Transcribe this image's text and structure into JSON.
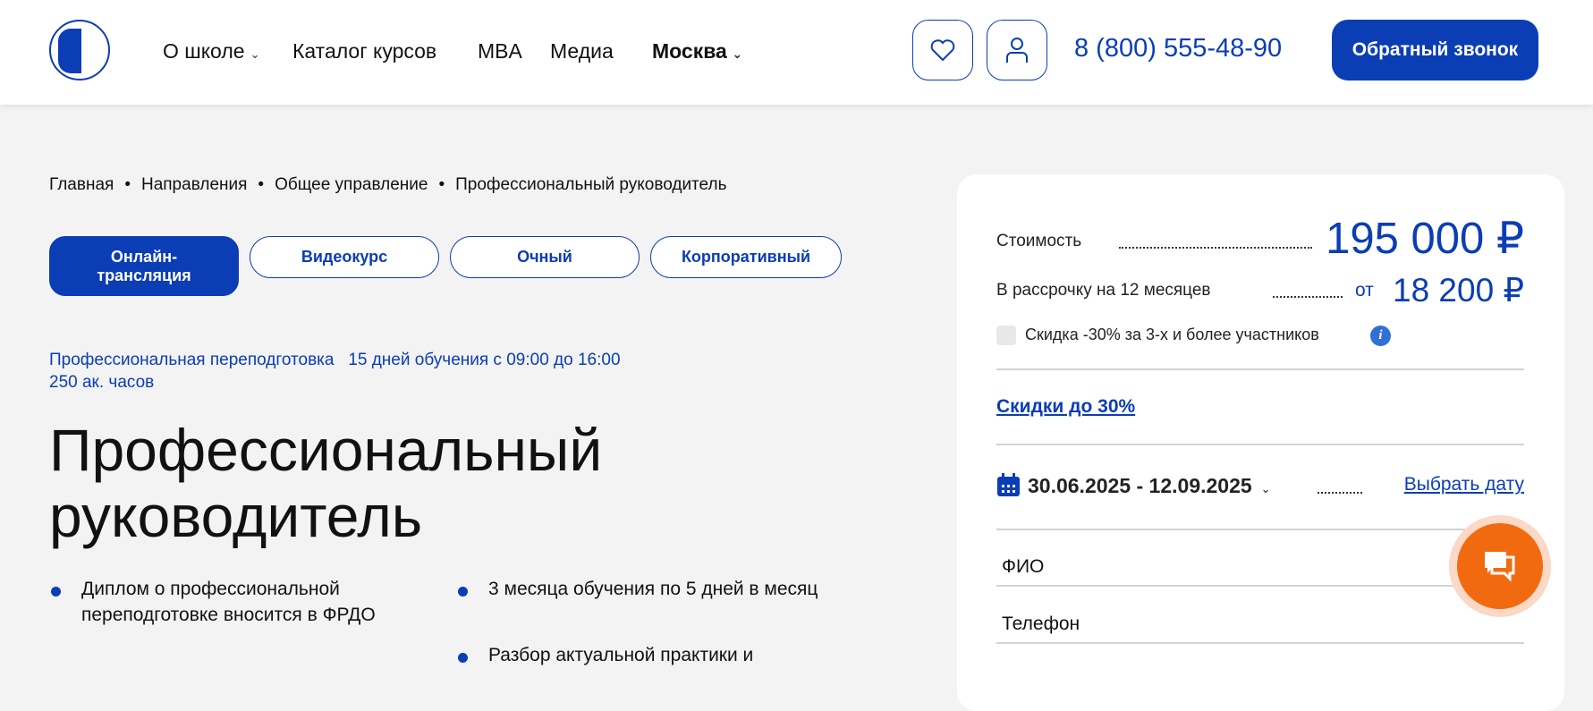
{
  "header": {
    "logo_alt": "lion logo",
    "nav": [
      {
        "label": "О школе",
        "dropdown": true
      },
      {
        "label": "Каталог курсов"
      },
      {
        "label": "MBA"
      },
      {
        "label": "Медиа"
      }
    ],
    "city": "Москва",
    "phone": "8 (800) 555-48-90",
    "callback_label": "Обратный звонок"
  },
  "breadcrumb": [
    "Главная",
    "Направления",
    "Общее управление",
    "Профессиональный руководитель"
  ],
  "format_tabs": [
    {
      "label": "Онлайн-трансляция",
      "active": true
    },
    {
      "label": "Видеокурс"
    },
    {
      "label": "Очный"
    },
    {
      "label": "Корпоративный"
    }
  ],
  "meta": {
    "type": "Профессиональная переподготовка",
    "schedule": "15 дней обучения с 09:00 до 16:00",
    "hours": "250 ак. часов"
  },
  "title_line1": "Профессиональный",
  "title_line2": "руководитель",
  "features": [
    "Диплом о профессиональной переподготовке вносится в ФРДО",
    "3 месяца обучения по 5 дней в месяц",
    "Разбор актуальной практики и"
  ],
  "pricing": {
    "cost_label": "Стоимость",
    "cost_value": "195 000 ₽",
    "installment_label": "В рассрочку на 12 месяцев",
    "installment_prefix": "от",
    "installment_value": "18 200 ₽",
    "discount_checkbox_label": "Скидка -30% за 3-х и более участников",
    "discount_checked": false,
    "discounts_link": "Скидки до 30%",
    "date_range": "30.06.2025 - 12.09.2025",
    "choose_date_link": "Выбрать дату"
  },
  "form": {
    "fio_placeholder": "ФИО",
    "phone_placeholder": "Телефон"
  },
  "colors": {
    "brand": "#0b3db5",
    "chat": "#f26a10",
    "background": "#f3f3f3"
  }
}
